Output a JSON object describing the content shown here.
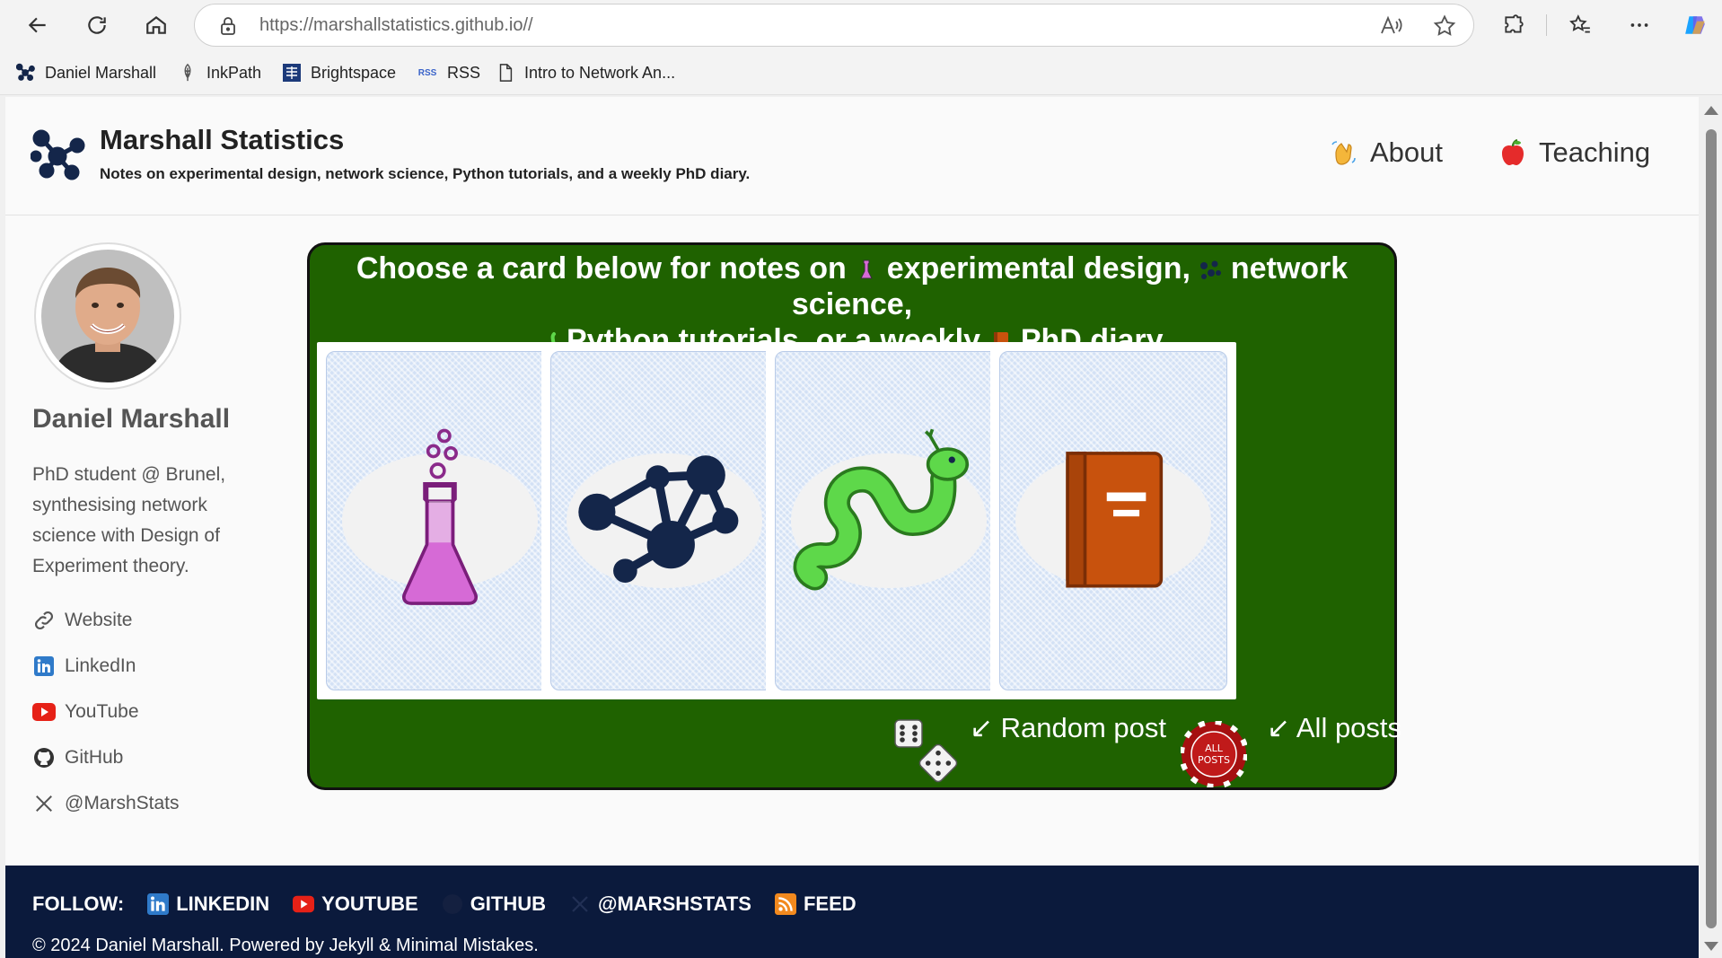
{
  "browser": {
    "url_domain": "https://marshallstatistics.github.io",
    "url_path": "//",
    "bookmarks": [
      {
        "label": "Daniel Marshall",
        "icon": "network-logo-icon"
      },
      {
        "label": "InkPath",
        "icon": "feather-icon"
      },
      {
        "label": "Brightspace",
        "icon": "brunel-crest-icon"
      },
      {
        "label": "RSS",
        "icon": "rss-text-icon"
      },
      {
        "label": "Intro to Network An...",
        "icon": "document-icon"
      }
    ],
    "rss_badge": "RSS"
  },
  "masthead": {
    "title": "Marshall Statistics",
    "subtitle": "Notes on experimental design, network science, Python tutorials, and a weekly PhD diary.",
    "nav": [
      {
        "label": "About",
        "icon": "waving-hand-icon"
      },
      {
        "label": "Teaching",
        "icon": "apple-icon"
      }
    ]
  },
  "sidebar": {
    "name": "Daniel Marshall",
    "bio": "PhD student @ Brunel, synthesising network science with Design of Experiment theory.",
    "links": [
      {
        "label": "Website",
        "icon": "link-icon"
      },
      {
        "label": "LinkedIn",
        "icon": "linkedin-icon"
      },
      {
        "label": "YouTube",
        "icon": "youtube-icon"
      },
      {
        "label": "GitHub",
        "icon": "github-icon"
      },
      {
        "label": "@MarshStats",
        "icon": "x-icon"
      }
    ]
  },
  "cards_panel": {
    "heading_parts": [
      "Choose a card below for notes on",
      "experimental design,",
      "network science,",
      "Python tutorials, or a weekly",
      "PhD diary."
    ],
    "cards": [
      {
        "topic": "experimental design",
        "icon": "flask-icon"
      },
      {
        "topic": "network science",
        "icon": "network-icon"
      },
      {
        "topic": "Python tutorials",
        "icon": "snake-icon"
      },
      {
        "topic": "PhD diary",
        "icon": "book-icon"
      }
    ],
    "random_post": "↙ Random post",
    "all_posts": "↙ All posts",
    "chip_text_top": "ALL",
    "chip_text_bottom": "POSTS"
  },
  "footer": {
    "follow_label": "FOLLOW:",
    "links": [
      {
        "label": "LINKEDIN",
        "icon": "linkedin-icon"
      },
      {
        "label": "YOUTUBE",
        "icon": "youtube-icon"
      },
      {
        "label": "GITHUB",
        "icon": "github-icon"
      },
      {
        "label": "@MARSHSTATS",
        "icon": "x-icon"
      },
      {
        "label": "FEED",
        "icon": "rss-icon"
      }
    ],
    "copyright": "© 2024 Daniel Marshall. Powered by Jekyll & Minimal Mistakes."
  },
  "colors": {
    "panel_green": "#1f6200",
    "footer_navy": "#0b1a3c",
    "card_blue": "#d3e1f5",
    "flask_pink": "#d66ad6",
    "snake_green": "#5ed84a",
    "book_orange": "#c8520d",
    "network_navy": "#14264a"
  }
}
